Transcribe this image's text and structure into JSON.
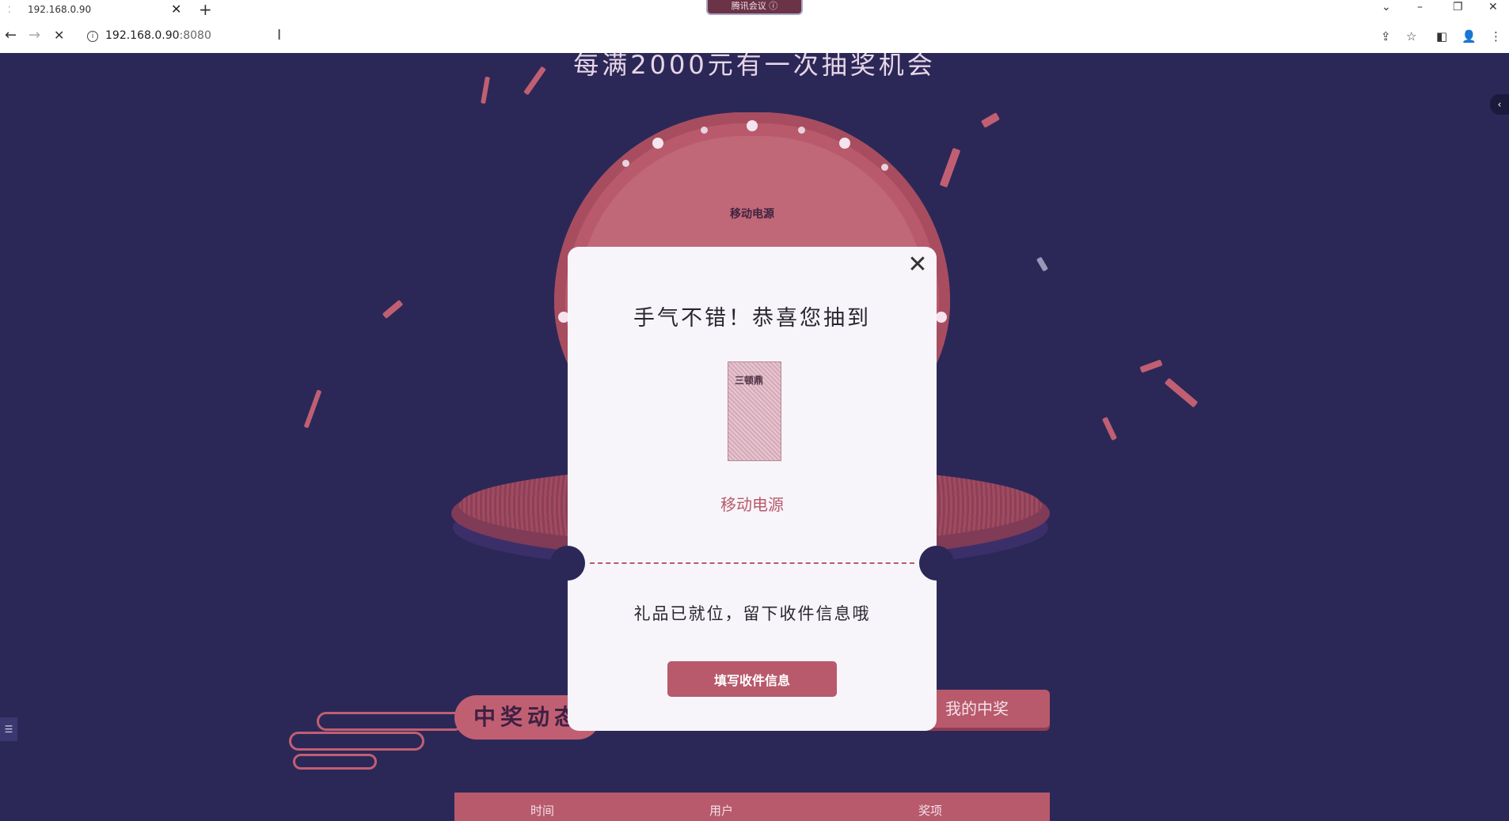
{
  "browser": {
    "tab_title": "192.168.0.90",
    "new_tab_symbol": "+",
    "close_symbol": "✕",
    "meeting_badge": "腾讯会议",
    "url_host": "192.168.0.90",
    "url_port": ":8080",
    "icons": [
      "back-icon",
      "forward-icon",
      "stop-icon",
      "info-icon",
      "share-icon",
      "star-icon",
      "sidebar-icon",
      "profile-icon",
      "menu-icon"
    ]
  },
  "page": {
    "headline": "每满2000元有一次抽奖机会",
    "wheel_label": "移动电源",
    "winners_title": "中奖动态",
    "my_wins_label": "我的中奖",
    "table_headers": [
      "时间",
      "用户",
      "奖项"
    ]
  },
  "modal": {
    "title": "手气不错！恭喜您抽到",
    "prize_image_label": "三顿鼎",
    "prize_name": "移动电源",
    "subtitle": "礼品已就位，留下收件信息哦",
    "button_label": "填写收件信息"
  },
  "colors": {
    "background": "#2b2858",
    "accent": "#b85a6c",
    "modal_bg": "#f7f5f9"
  }
}
